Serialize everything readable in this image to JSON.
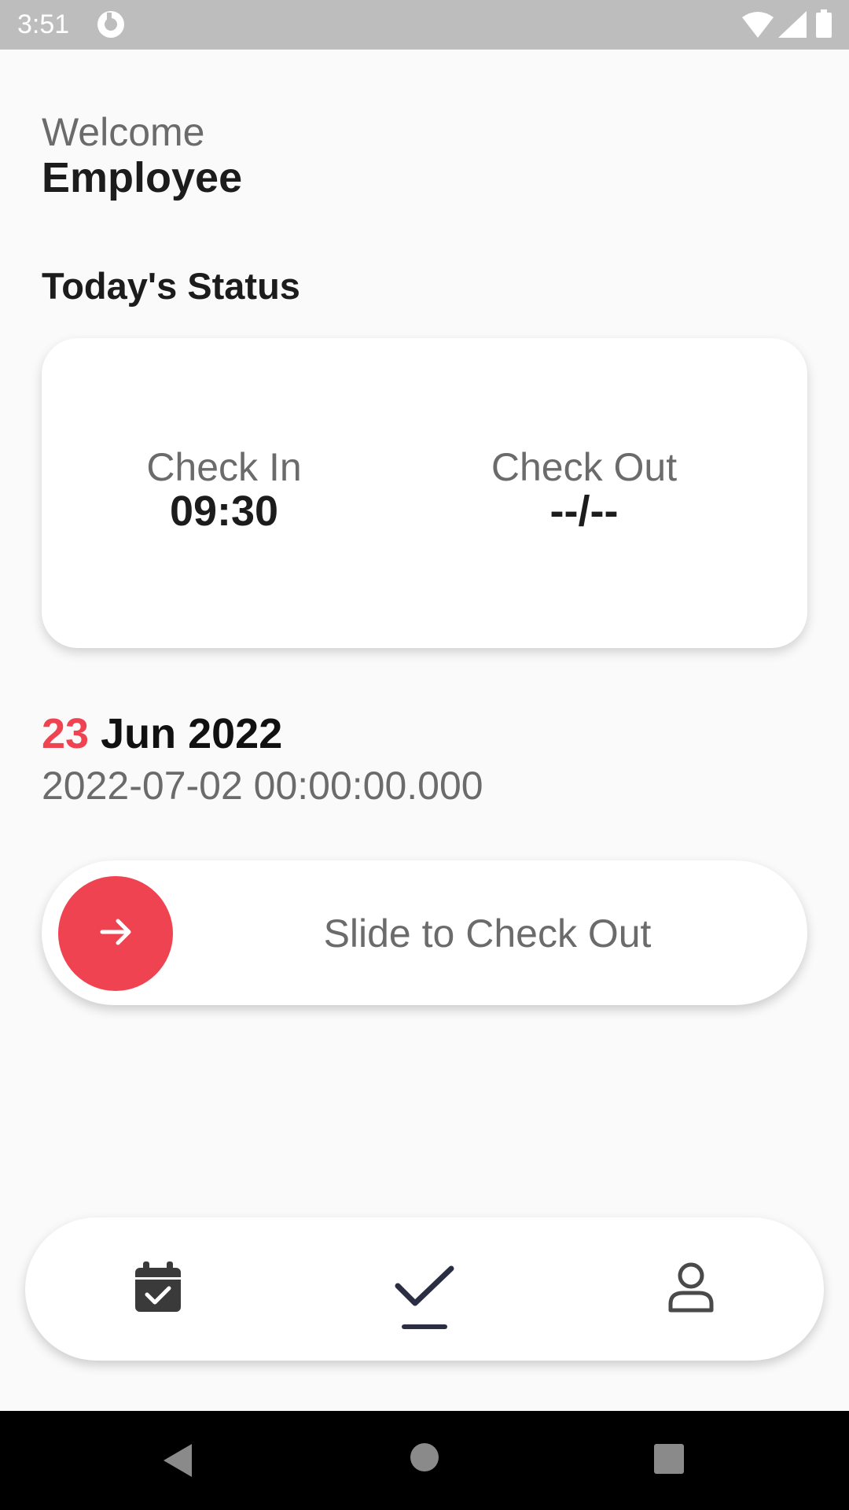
{
  "status_bar": {
    "time": "3:51"
  },
  "header": {
    "welcome": "Welcome",
    "user_name": "Employee"
  },
  "section_title": "Today's Status",
  "status_card": {
    "check_in_label": "Check In",
    "check_in_value": "09:30",
    "check_out_label": "Check Out",
    "check_out_value": "--/--"
  },
  "date": {
    "day": "23",
    "month_year": "Jun 2022",
    "timestamp": "2022-07-02 00:00:00.000"
  },
  "slider": {
    "label": "Slide to Check Out"
  },
  "bottom_nav": {
    "items": [
      {
        "icon": "calendar-check-icon"
      },
      {
        "icon": "check-icon",
        "active": true
      },
      {
        "icon": "person-icon"
      }
    ]
  },
  "colors": {
    "accent": "#ef4351",
    "text_dark": "#1c1c1c",
    "text_muted": "#6b6b6b",
    "nav_icon": "#2b2d42"
  }
}
